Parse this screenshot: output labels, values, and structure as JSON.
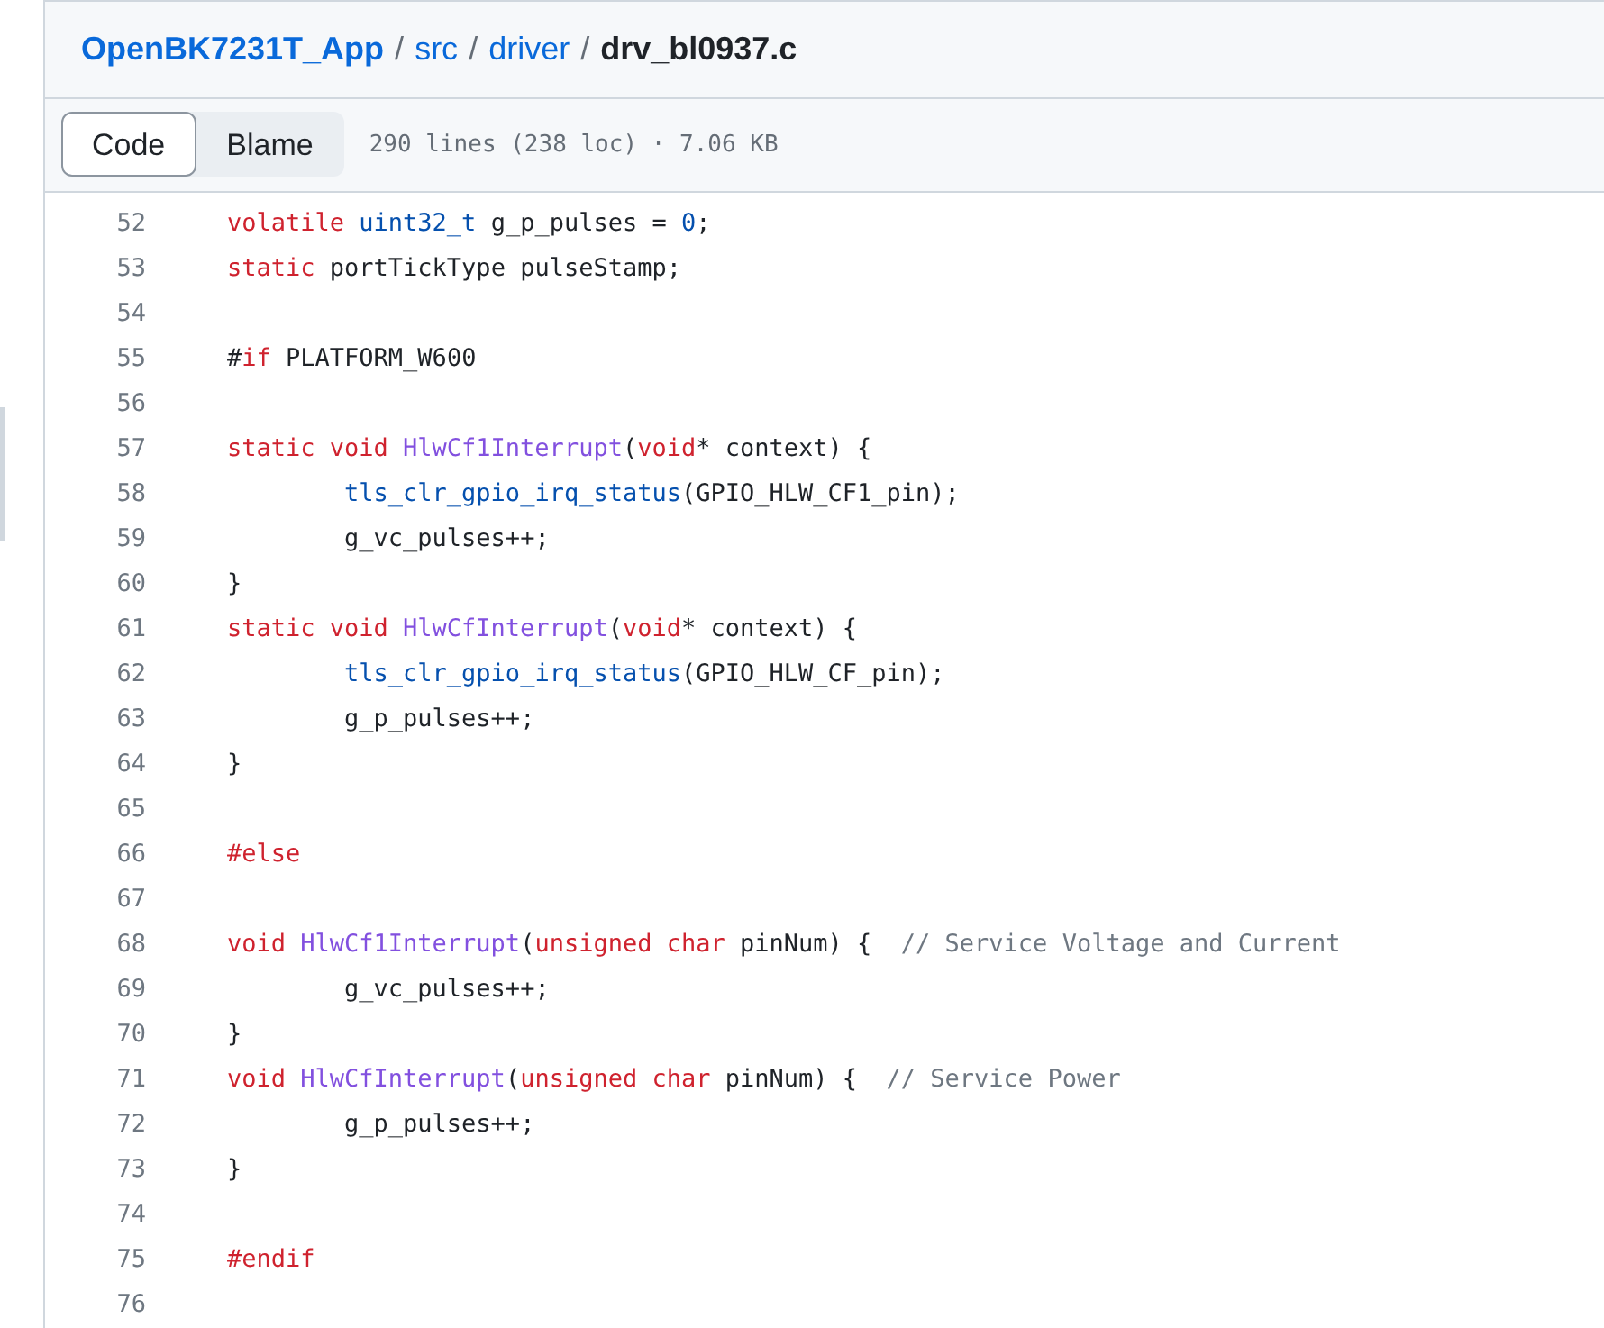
{
  "breadcrumb": {
    "repo": "OpenBK7231T_App",
    "path": [
      {
        "text": "src"
      },
      {
        "text": "driver"
      }
    ],
    "separator": "/",
    "file": "drv_bl0937.c"
  },
  "toolbar": {
    "tabs": [
      {
        "label": "Code",
        "selected": true
      },
      {
        "label": "Blame",
        "selected": false
      }
    ],
    "info": "290 lines (238 loc) · 7.06 KB"
  },
  "code_lines": [
    {
      "number": "52",
      "tokens": [
        {
          "kind": "keyword",
          "text": "volatile"
        },
        {
          "kind": "type",
          "text": " uint32_t"
        },
        {
          "kind": "plain",
          "text": " g_p_pulses = "
        },
        {
          "kind": "number",
          "text": "0"
        },
        {
          "kind": "plain",
          "text": ";"
        }
      ]
    },
    {
      "number": "53",
      "tokens": [
        {
          "kind": "keyword",
          "text": "static"
        },
        {
          "kind": "plain",
          "text": " portTickType pulseStamp;"
        }
      ]
    },
    {
      "number": "54"
    },
    {
      "number": "55",
      "tokens": [
        {
          "kind": "plain",
          "text": "#"
        },
        {
          "kind": "keyword",
          "text": "if"
        },
        {
          "kind": "plain",
          "text": " PLATFORM_W600"
        }
      ]
    },
    {
      "number": "56"
    },
    {
      "number": "57",
      "tokens": [
        {
          "kind": "keyword",
          "text": "static void"
        },
        {
          "kind": "function",
          "text": " HlwCf1Interrupt"
        },
        {
          "kind": "plain",
          "text": "("
        },
        {
          "kind": "keyword",
          "text": "void"
        },
        {
          "kind": "plain",
          "text": "* context) {"
        }
      ]
    },
    {
      "number": "58",
      "tokens": [
        {
          "kind": "call",
          "text": "\ttls_clr_gpio_irq_status"
        },
        {
          "kind": "plain",
          "text": "(GPIO_HLW_CF1_pin);"
        }
      ]
    },
    {
      "number": "59",
      "tokens": [
        {
          "kind": "plain",
          "text": "\tg_vc_pulses++;"
        }
      ]
    },
    {
      "number": "60",
      "tokens": [
        {
          "kind": "plain",
          "text": "}"
        }
      ]
    },
    {
      "number": "61",
      "tokens": [
        {
          "kind": "keyword",
          "text": "static void"
        },
        {
          "kind": "function",
          "text": " HlwCfInterrupt"
        },
        {
          "kind": "plain",
          "text": "("
        },
        {
          "kind": "keyword",
          "text": "void"
        },
        {
          "kind": "plain",
          "text": "* context) {"
        }
      ]
    },
    {
      "number": "62",
      "tokens": [
        {
          "kind": "call",
          "text": "\ttls_clr_gpio_irq_status"
        },
        {
          "kind": "plain",
          "text": "(GPIO_HLW_CF_pin);"
        }
      ]
    },
    {
      "number": "63",
      "tokens": [
        {
          "kind": "plain",
          "text": "\tg_p_pulses++;"
        }
      ]
    },
    {
      "number": "64",
      "tokens": [
        {
          "kind": "plain",
          "text": "}"
        }
      ]
    },
    {
      "number": "65"
    },
    {
      "number": "66",
      "tokens": [
        {
          "kind": "keyword",
          "text": "#else"
        }
      ]
    },
    {
      "number": "67"
    },
    {
      "number": "68",
      "tokens": [
        {
          "kind": "keyword",
          "text": "void"
        },
        {
          "kind": "function",
          "text": " HlwCf1Interrupt"
        },
        {
          "kind": "plain",
          "text": "("
        },
        {
          "kind": "keyword",
          "text": "unsigned char"
        },
        {
          "kind": "plain",
          "text": " pinNum) {"
        },
        {
          "kind": "comment",
          "text": "  // Service Voltage and Current"
        }
      ]
    },
    {
      "number": "69",
      "tokens": [
        {
          "kind": "plain",
          "text": "\tg_vc_pulses++;"
        }
      ]
    },
    {
      "number": "70",
      "tokens": [
        {
          "kind": "plain",
          "text": "}"
        }
      ]
    },
    {
      "number": "71",
      "tokens": [
        {
          "kind": "keyword",
          "text": "void"
        },
        {
          "kind": "function",
          "text": " HlwCfInterrupt"
        },
        {
          "kind": "plain",
          "text": "("
        },
        {
          "kind": "keyword",
          "text": "unsigned char"
        },
        {
          "kind": "plain",
          "text": " pinNum) {"
        },
        {
          "kind": "comment",
          "text": "  // Service Power"
        }
      ]
    },
    {
      "number": "72",
      "tokens": [
        {
          "kind": "plain",
          "text": "\tg_p_pulses++;"
        }
      ]
    },
    {
      "number": "73",
      "tokens": [
        {
          "kind": "plain",
          "text": "}"
        }
      ]
    },
    {
      "number": "74"
    },
    {
      "number": "75",
      "tokens": [
        {
          "kind": "keyword",
          "text": "#endif"
        }
      ]
    },
    {
      "number": "76"
    }
  ]
}
